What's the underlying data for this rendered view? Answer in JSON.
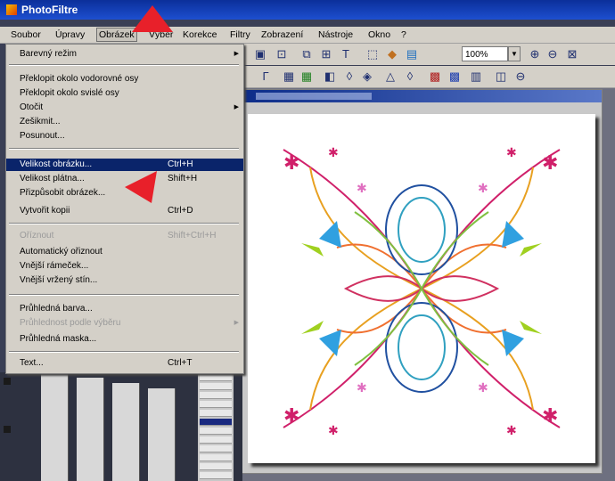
{
  "window": {
    "title": "PhotoFiltre"
  },
  "menubar": {
    "items": [
      "Soubor",
      "Úpravy",
      "Obrázek",
      "Výběr",
      "Korekce",
      "Filtry",
      "Zobrazení",
      "Nástroje",
      "Okno",
      "?"
    ],
    "active": "Obrázek"
  },
  "toolbar": {
    "zoom_value": "100%"
  },
  "image_menu": {
    "items": [
      {
        "label": "Barevný režim",
        "submenu": true
      },
      {
        "label": "Překlopit okolo vodorovné osy"
      },
      {
        "label": "Překlopit okolo svislé osy"
      },
      {
        "label": "Otočit",
        "submenu": true
      },
      {
        "label": "Zešikmit..."
      },
      {
        "label": "Posunout..."
      },
      {
        "label": "Velikost obrázku...",
        "shortcut": "Ctrl+H",
        "selected": true
      },
      {
        "label": "Velikost plátna...",
        "shortcut": "Shift+H"
      },
      {
        "label": "Přizpůsobit obrázek..."
      },
      {
        "label": "Vytvořit kopii",
        "shortcut": "Ctrl+D"
      },
      {
        "label": "Oříznout",
        "shortcut": "Shift+Ctrl+H",
        "disabled": true
      },
      {
        "label": "Automatický ořiznout"
      },
      {
        "label": "Vnější rámeček..."
      },
      {
        "label": "Vnější vržený stín..."
      },
      {
        "label": "Průhledná barva..."
      },
      {
        "label": "Průhlednost podle výběru",
        "submenu": true,
        "disabled": true
      },
      {
        "label": "Průhledná maska..."
      },
      {
        "label": "Text...",
        "shortcut": "Ctrl+T"
      }
    ]
  },
  "colors": {
    "titlebar": "#0b2f9a",
    "menu_bg": "#d4d0c8",
    "selection": "#0a246a",
    "annotation_arrow": "#e8202a"
  }
}
